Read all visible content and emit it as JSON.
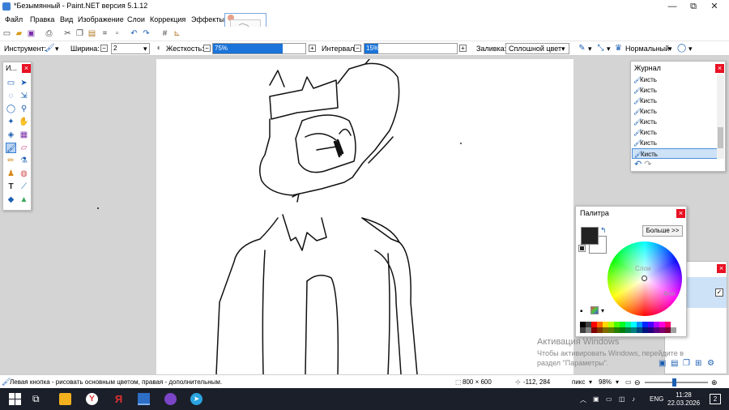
{
  "window": {
    "title": "*Безымянный - Paint.NET версия 5.1.12",
    "minimize": "—",
    "maximize": "⧉",
    "close": "✕"
  },
  "menu": [
    "Файл",
    "Правка",
    "Вид",
    "Изображение",
    "Слои",
    "Коррекция",
    "Эффекты"
  ],
  "toolbar": {
    "tool_label": "Инструмент:",
    "width_label": "Ширина:",
    "width_value": "2",
    "hardness_label": "Жесткость:",
    "hardness_value": "75%",
    "hardness_level": 0.75,
    "interval_label": "Интервал:",
    "interval_value": "15%",
    "interval_level": 0.15,
    "fill_label": "Заливка:",
    "fill_value": "Сплошной цвет",
    "blend_value": "Нормальный"
  },
  "tools_panel": {
    "title": "И..."
  },
  "history_panel": {
    "title": "Журнал",
    "items": [
      "Кисть",
      "Кисть",
      "Кисть",
      "Кисть",
      "Кисть",
      "Кисть",
      "Кисть",
      "Кисть"
    ],
    "selected_index": 7
  },
  "palette_panel": {
    "title": "Палитра",
    "more_button": "Больше >>",
    "primary_color": "#222222",
    "secondary_color": "#ffffff"
  },
  "layers_panel": {
    "peek_label_1": "Слои",
    "peek_label_2": "Фон"
  },
  "watermark": {
    "line1": "Активация Windows",
    "line2": "Чтобы активировать Windows, перейдите в",
    "line3": "раздел \"Параметры\"."
  },
  "status": {
    "hint": "Левая кнопка - рисовать основным цветом, правая - дополнительным.",
    "image_size": "800 × 600",
    "cursor_pos": "-112, 284",
    "units": "пикс",
    "zoom": "98%"
  },
  "taskbar": {
    "language": "ENG",
    "time": "11:28",
    "date": "22.03.2026",
    "notifications": "2"
  }
}
